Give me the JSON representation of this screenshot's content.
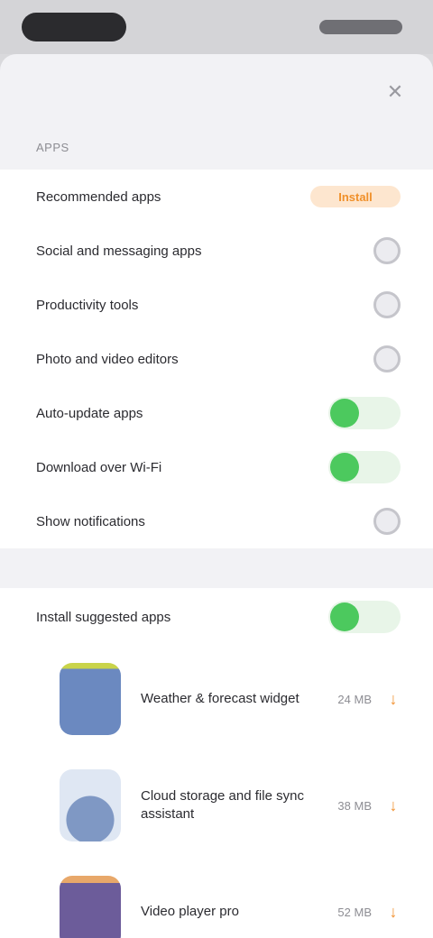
{
  "sheet": {
    "section_label": "Apps",
    "rows": [
      {
        "label": "Recommended apps",
        "control": "badge",
        "badge": "Install"
      },
      {
        "label": "Social and messaging apps",
        "control": "check"
      },
      {
        "label": "Productivity tools",
        "control": "check"
      },
      {
        "label": "Photo and video editors",
        "control": "check"
      },
      {
        "label": "Auto-update apps",
        "control": "toggle"
      },
      {
        "label": "Download over Wi-Fi",
        "control": "toggle"
      },
      {
        "label": "Show notifications",
        "control": "check"
      }
    ],
    "auto_install": {
      "label": "Install suggested apps",
      "control": "toggle"
    },
    "apps": [
      {
        "name": "Weather & forecast widget",
        "size": "24 MB"
      },
      {
        "name": "Cloud storage and file sync assistant",
        "size": "38 MB"
      },
      {
        "name": "Video player pro",
        "size": "52 MB"
      }
    ],
    "colors": {
      "accent": "#f1902e",
      "toggle_on": "#4cc95e"
    }
  }
}
